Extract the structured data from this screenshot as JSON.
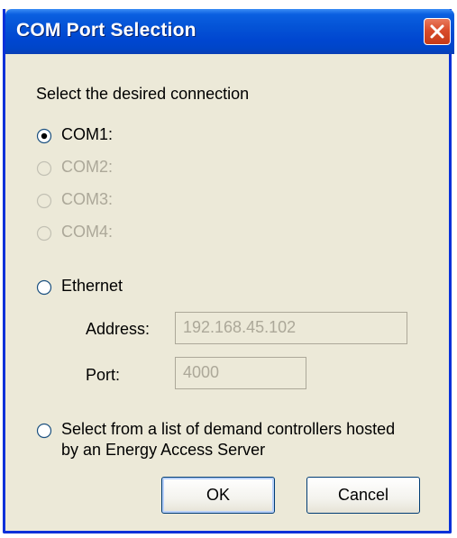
{
  "window": {
    "title": "COM Port Selection"
  },
  "dialog": {
    "prompt": "Select the desired connection",
    "options": [
      {
        "label": "COM1:",
        "selected": true,
        "enabled": true
      },
      {
        "label": "COM2:",
        "selected": false,
        "enabled": false
      },
      {
        "label": "COM3:",
        "selected": false,
        "enabled": false
      },
      {
        "label": "COM4:",
        "selected": false,
        "enabled": false
      },
      {
        "label": "Ethernet",
        "selected": false,
        "enabled": true
      }
    ],
    "ethernet": {
      "address_label": "Address:",
      "address_value": "192.168.45.102",
      "port_label": "Port:",
      "port_value": "4000"
    },
    "server_option": {
      "line1": "Select from a list of demand controllers hosted",
      "line2": "by an Energy Access Server",
      "selected": false
    },
    "ok_label": "OK",
    "cancel_label": "Cancel"
  },
  "colors": {
    "titlebar": "#0453d6",
    "dialog_bg": "#ece9d8",
    "disabled_text": "#aca899",
    "close_button": "#d94c2c"
  }
}
